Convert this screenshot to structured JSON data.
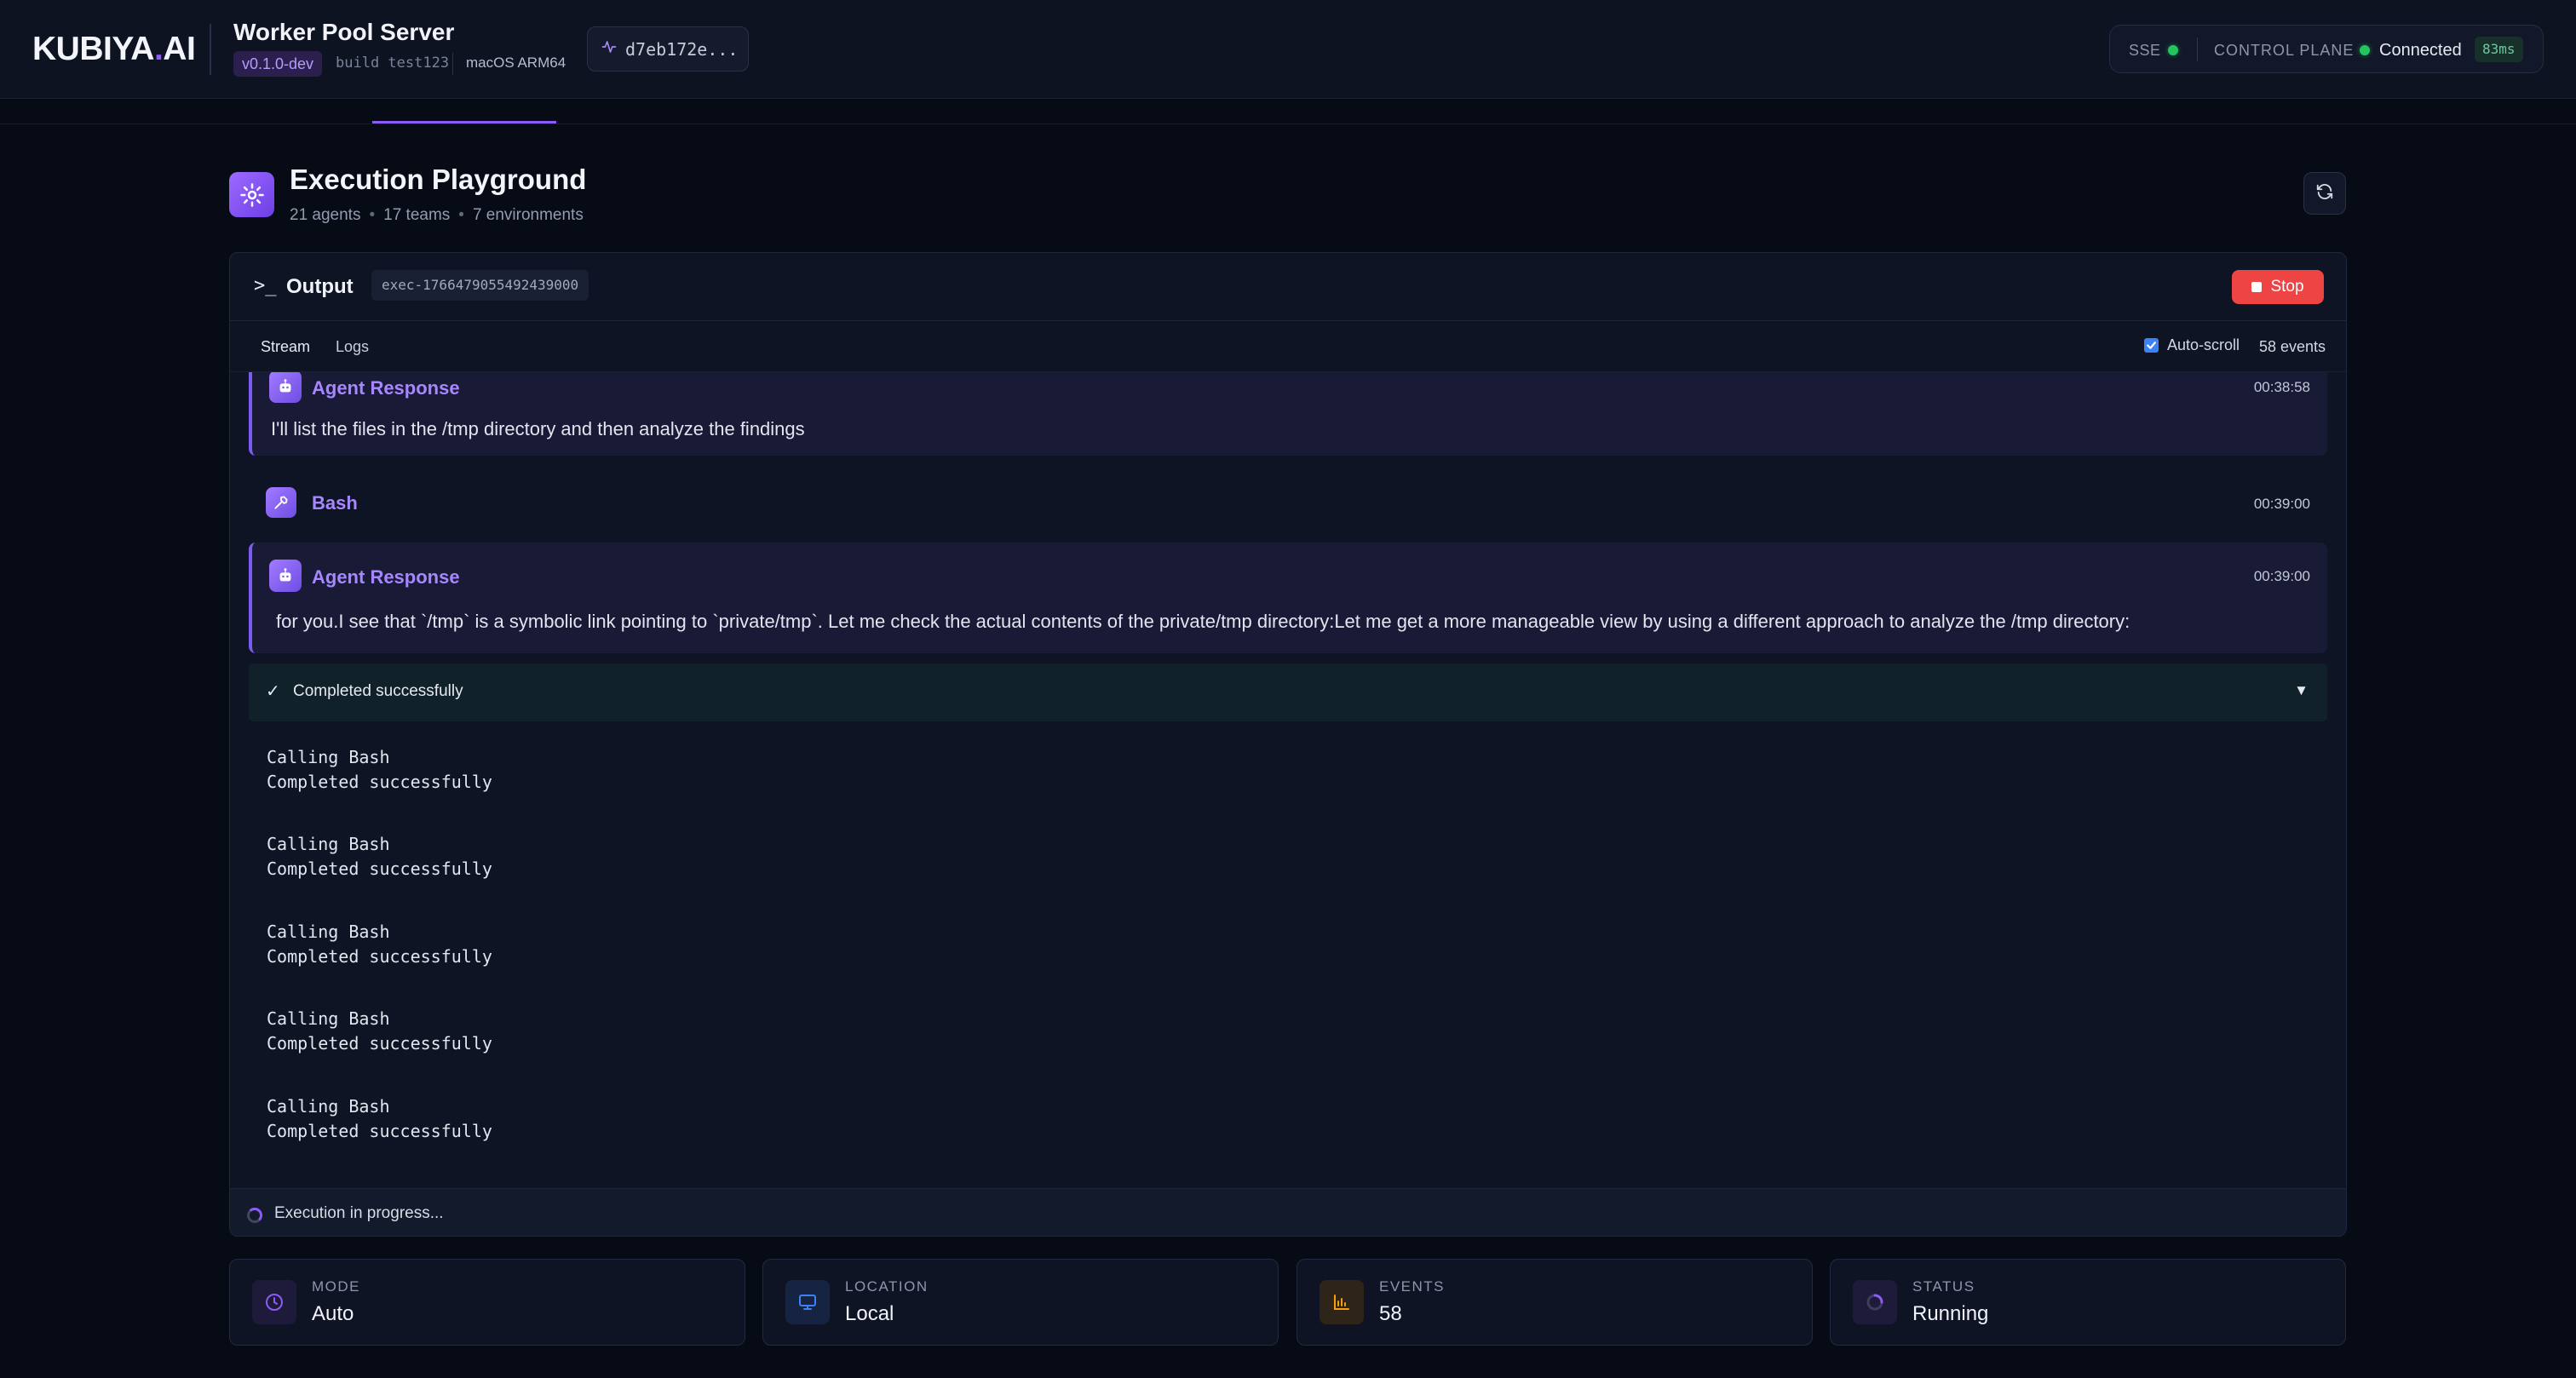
{
  "header": {
    "logo_main": "KUBIYA",
    "logo_dot": ".",
    "logo_suffix": "AI",
    "server_title": "Worker Pool Server",
    "version": "v0.1.0-dev",
    "build": "build test123",
    "os": "macOS ARM64",
    "commit": "d7eb172e...",
    "sse_label": "SSE",
    "control_plane_label": "CONTROL PLANE",
    "connection_status": "Connected",
    "latency": "83ms",
    "status_color": "#22c55e",
    "accent_color": "#8b5cf6"
  },
  "page": {
    "title": "Execution Playground",
    "agents": "21 agents",
    "teams": "17 teams",
    "environments": "7 environments",
    "separator": "•",
    "icon": "gear-icon",
    "refresh_icon": "refresh-icon"
  },
  "output": {
    "title": "Output",
    "prompt_symbol": ">_",
    "exec_id": "exec-1766479055492439000",
    "stop_label": "Stop",
    "tabs": [
      {
        "label": "Stream",
        "active": true
      },
      {
        "label": "Logs",
        "active": false
      }
    ],
    "autoscroll_label": "Auto-scroll",
    "autoscroll_checked": true,
    "events_count": "58 events"
  },
  "stream": {
    "events": [
      {
        "type": "agent",
        "label": "Agent Response",
        "time": "00:38:58",
        "text": "I'll list the files in the /tmp directory and then analyze the findings"
      },
      {
        "type": "tool",
        "label": "Bash",
        "time": "00:39:00"
      },
      {
        "type": "agent",
        "label": "Agent Response",
        "time": "00:39:00",
        "text": "for you.I see that `/tmp` is a symbolic link pointing to `private/tmp`. Let me check the actual contents of the private/tmp directory:Let me get a more manageable view by using a different approach to analyze the /tmp directory:"
      }
    ],
    "completed": {
      "label": "Completed successfully",
      "check": "✓",
      "caret": "▼"
    },
    "logs": [
      {
        "line1": "Calling Bash",
        "line2": "Completed successfully"
      },
      {
        "line1": "Calling Bash",
        "line2": "Completed successfully"
      },
      {
        "line1": "Calling Bash",
        "line2": "Completed successfully"
      },
      {
        "line1": "Calling Bash",
        "line2": "Completed successfully"
      },
      {
        "line1": "Calling Bash",
        "line2": "Completed successfully"
      }
    ],
    "progress_text": "Execution in progress..."
  },
  "stats": [
    {
      "label": "MODE",
      "value": "Auto",
      "icon": "clock-icon",
      "color": "#8b5cf6"
    },
    {
      "label": "LOCATION",
      "value": "Local",
      "icon": "monitor-icon",
      "color": "#3b82f6"
    },
    {
      "label": "EVENTS",
      "value": "58",
      "icon": "bar-chart-icon",
      "color": "#f59e0b"
    },
    {
      "label": "STATUS",
      "value": "Running",
      "icon": "spinner-icon",
      "color": "#8b5cf6"
    }
  ]
}
